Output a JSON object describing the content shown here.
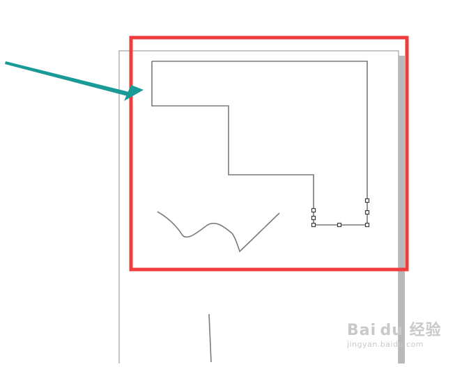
{
  "watermark": {
    "brand": "Bai du 经验",
    "url": "jingyan.baidu.com"
  },
  "colors": {
    "highlight_box": "#f03c3c",
    "arrow": "#1a9a96",
    "page_border": "#b4b4b4",
    "page_shadow": "#b9b9b9",
    "drawn_lines": "#7a7a7a",
    "handles": "#3a3a3a"
  },
  "icons": {
    "pointer": "arrow-icon"
  }
}
